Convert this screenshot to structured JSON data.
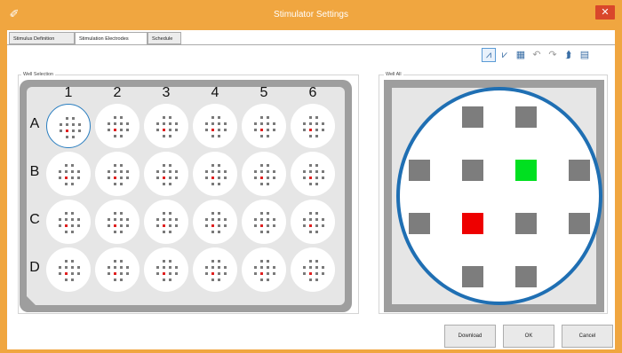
{
  "window": {
    "title": "Stimulator Settings",
    "app_icon": "flask-icon",
    "close_glyph": "✕",
    "accent_color": "#f0a640"
  },
  "tabs": [
    {
      "label": "Stimulus Definition",
      "active": false
    },
    {
      "label": "Stimulation Electrodes",
      "active": true
    },
    {
      "label": "Schedule",
      "active": false
    }
  ],
  "toolbar": [
    {
      "icon": "waveform-select-icon",
      "glyph": "⩘",
      "active": true,
      "enabled": true
    },
    {
      "icon": "waveform-add-icon",
      "glyph": "⩗",
      "active": false,
      "enabled": true
    },
    {
      "icon": "grid-select-icon",
      "glyph": "▦",
      "active": false,
      "enabled": true
    },
    {
      "icon": "undo-icon",
      "glyph": "↶",
      "active": false,
      "enabled": false
    },
    {
      "icon": "redo-icon",
      "glyph": "↷",
      "active": false,
      "enabled": false
    },
    {
      "icon": "copy-to-wells-icon",
      "glyph": "⮭",
      "active": false,
      "enabled": true
    },
    {
      "icon": "paste-icon",
      "glyph": "▤",
      "active": false,
      "enabled": true
    }
  ],
  "well_selection": {
    "label": "Well Selection",
    "columns": [
      "1",
      "2",
      "3",
      "4",
      "5",
      "6"
    ],
    "rows": [
      "A",
      "B",
      "C",
      "D"
    ],
    "selected_well": "A1",
    "stim_electrode": "row 3, col 1 of 8-electrode layout"
  },
  "well_all": {
    "label": "Well All",
    "electrode_layout_rows": [
      [
        "",
        "g",
        "g",
        ""
      ],
      [
        "g",
        "g",
        "G",
        "g"
      ],
      [
        "g",
        "R",
        "g",
        "g"
      ],
      [
        "",
        "g",
        "g",
        ""
      ]
    ],
    "colors": {
      "electrode": "#7d7d7d",
      "selected": "#00e020",
      "stimulating": "#ee0000",
      "ring": "#1f6fb3"
    }
  },
  "buttons": {
    "download": "Download",
    "ok": "OK",
    "cancel": "Cancel"
  }
}
